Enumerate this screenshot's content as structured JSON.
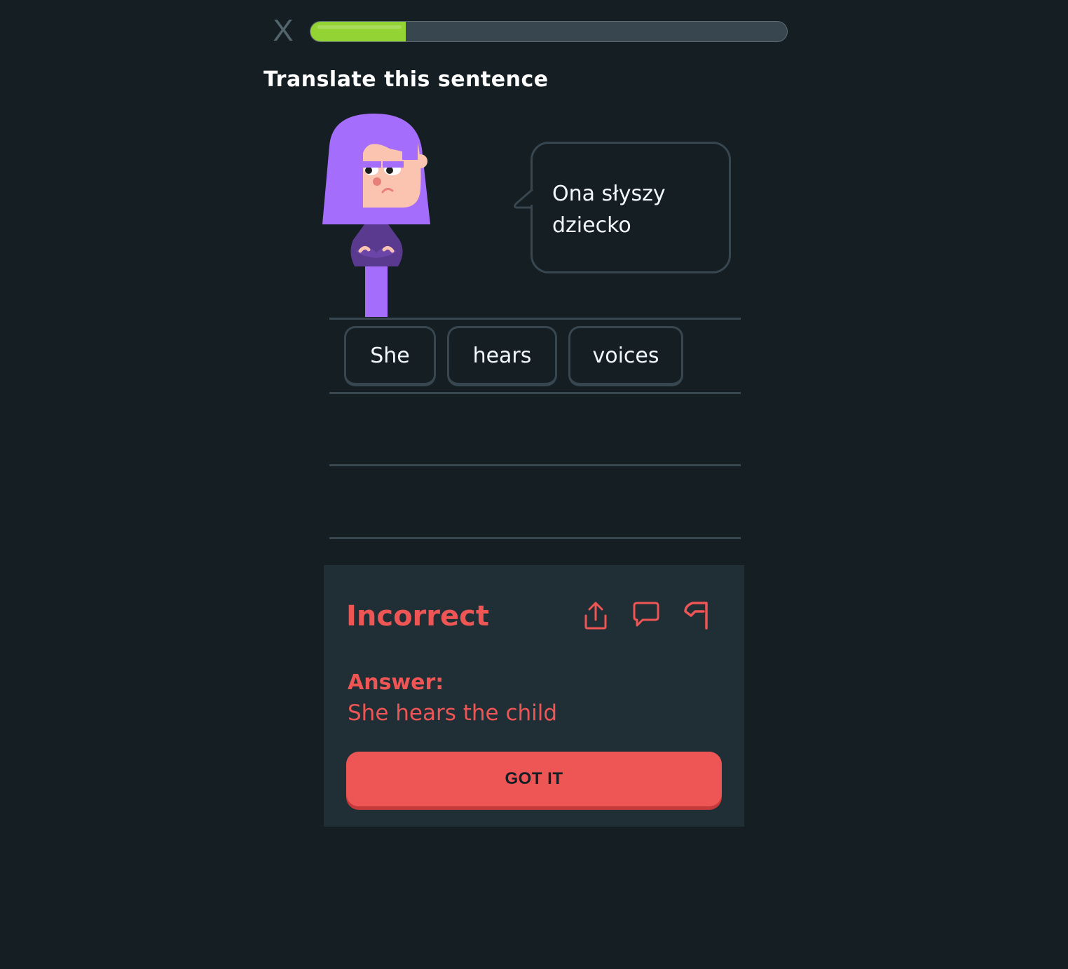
{
  "header": {
    "close_label": "X",
    "progress_percent": 20
  },
  "prompt": {
    "title": "Translate this sentence"
  },
  "speech": {
    "line1": "Ona słyszy",
    "line2": "dziecko"
  },
  "answer_bank": {
    "selected_words": [
      "She",
      "hears",
      "voices"
    ]
  },
  "feedback": {
    "status": "Incorrect",
    "answer_label": "Answer:",
    "correct_answer": "She hears the child",
    "button_label": "GOT IT",
    "icons": [
      "share-icon",
      "comment-icon",
      "flag-icon"
    ]
  },
  "colors": {
    "background": "#151e23",
    "progress_fill": "#93d333",
    "error": "#ee5555",
    "panel": "#202f36",
    "border": "#37464f"
  }
}
